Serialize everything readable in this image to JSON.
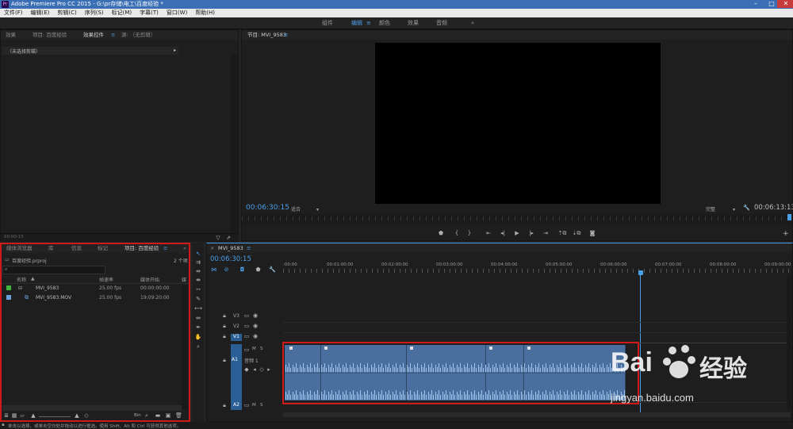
{
  "window": {
    "title": "Adobe Premiere Pro CC 2015 - G:\\pr存储\\电工\\百度经验 *",
    "logo": "Pr",
    "controls": [
      "minimize-icon",
      "maximize-icon",
      "close-icon"
    ]
  },
  "menu": [
    "文件(F)",
    "编辑(E)",
    "剪辑(C)",
    "序列(S)",
    "标记(M)",
    "字幕(T)",
    "窗口(W)",
    "帮助(H)"
  ],
  "workspaces": {
    "items": [
      "组件",
      "编辑",
      "颜色",
      "效果",
      "音频"
    ],
    "active": "编辑",
    "active_menu_icon": "≡",
    "more": "»"
  },
  "effect_controls": {
    "tabs": [
      "效果",
      "项目: 百度经验",
      "效果控件",
      "源: （无剪辑）"
    ],
    "active_tab": "效果控件",
    "tab_menu_icon": "≡",
    "no_clip": "（未选择剪辑）",
    "expand_icon": "▸",
    "timecode": "00:00:15"
  },
  "program_monitor": {
    "title": "节目: MVI_9583",
    "title_menu_icon": "≡",
    "timecode_left": "00:06:30:15",
    "fit": "适合",
    "quality": "完整",
    "timecode_right": "00:06:13:13",
    "dropdown_icon": "▾",
    "settings_icon": "🔧",
    "add_icon": "+",
    "controls": [
      "marker-icon",
      "mark-in-icon",
      "mark-out-icon",
      "go-to-in-icon",
      "step-back-icon",
      "play-icon",
      "step-forward-icon",
      "go-to-out-icon",
      "lift-icon",
      "extract-icon",
      "export-frame-icon"
    ]
  },
  "project": {
    "tabs": [
      "媒体浏览器",
      "库",
      "信息",
      "标记",
      "项目: 百度经验"
    ],
    "active_tab": "项目: 百度经验",
    "active_tab_menu_icon": "≡",
    "more": "»",
    "file": "百度经验.prproj",
    "count": "2 个项",
    "search_icon": "🔍",
    "columns": [
      "名称",
      "帧速率",
      "媒体开始",
      "媒"
    ],
    "sort_icon": "▲",
    "items": [
      {
        "name": "MVI_9583",
        "fps": "25.00 fps",
        "start": "00:00:00:00",
        "color": "#3fb53f"
      },
      {
        "name": "MVI_9583.MOV",
        "fps": "25.00 fps",
        "start": "19:09:20:00",
        "color": "#6a9fd8"
      }
    ],
    "bottom_bin": "Bin"
  },
  "tools": [
    "selection-icon",
    "track-select-icon",
    "ripple-edit-icon",
    "rolling-edit-icon",
    "rate-stretch-icon",
    "razor-icon",
    "slip-icon",
    "slide-icon",
    "pen-icon",
    "hand-icon",
    "zoom-icon"
  ],
  "timeline": {
    "close": "×",
    "tab": "MVI_9583",
    "tab_menu_icon": "≡",
    "timecode": "00:06:30:15",
    "ruler": [
      ":00:00",
      "00:01:00:00",
      "00:02:00:00",
      "00:03:00:00",
      "00:04:00:00",
      "00:05:00:00",
      "00:06:00:00",
      "00:07:00:00",
      "00:08:00:00",
      "00:09:00:00"
    ],
    "playhead_fraction": 0.69,
    "tracks": {
      "video": [
        "V3",
        "V2",
        "V1"
      ],
      "audio": [
        "A1",
        "A2"
      ],
      "audio_label": "音频 1",
      "mute": "M",
      "solo": "S",
      "lock_icon": "lock-icon",
      "eye_icon": "eye-icon",
      "mic_icon": "mic-icon"
    },
    "clip_fx": "fx"
  },
  "status_bar": "单击以选择，或单击空白处并拖动以进行框选。使用 Shift、Alt 和 Ctrl 可获得其他选项。",
  "watermark": {
    "brand_a": "Bai",
    "brand_b": "经验",
    "url": "jingyan.baidu.com"
  },
  "colors": {
    "accent": "#4b9fe8",
    "title_bar": "#3a6fb6",
    "highlight": "#d01a1a",
    "clip": "#4a6f9e"
  }
}
